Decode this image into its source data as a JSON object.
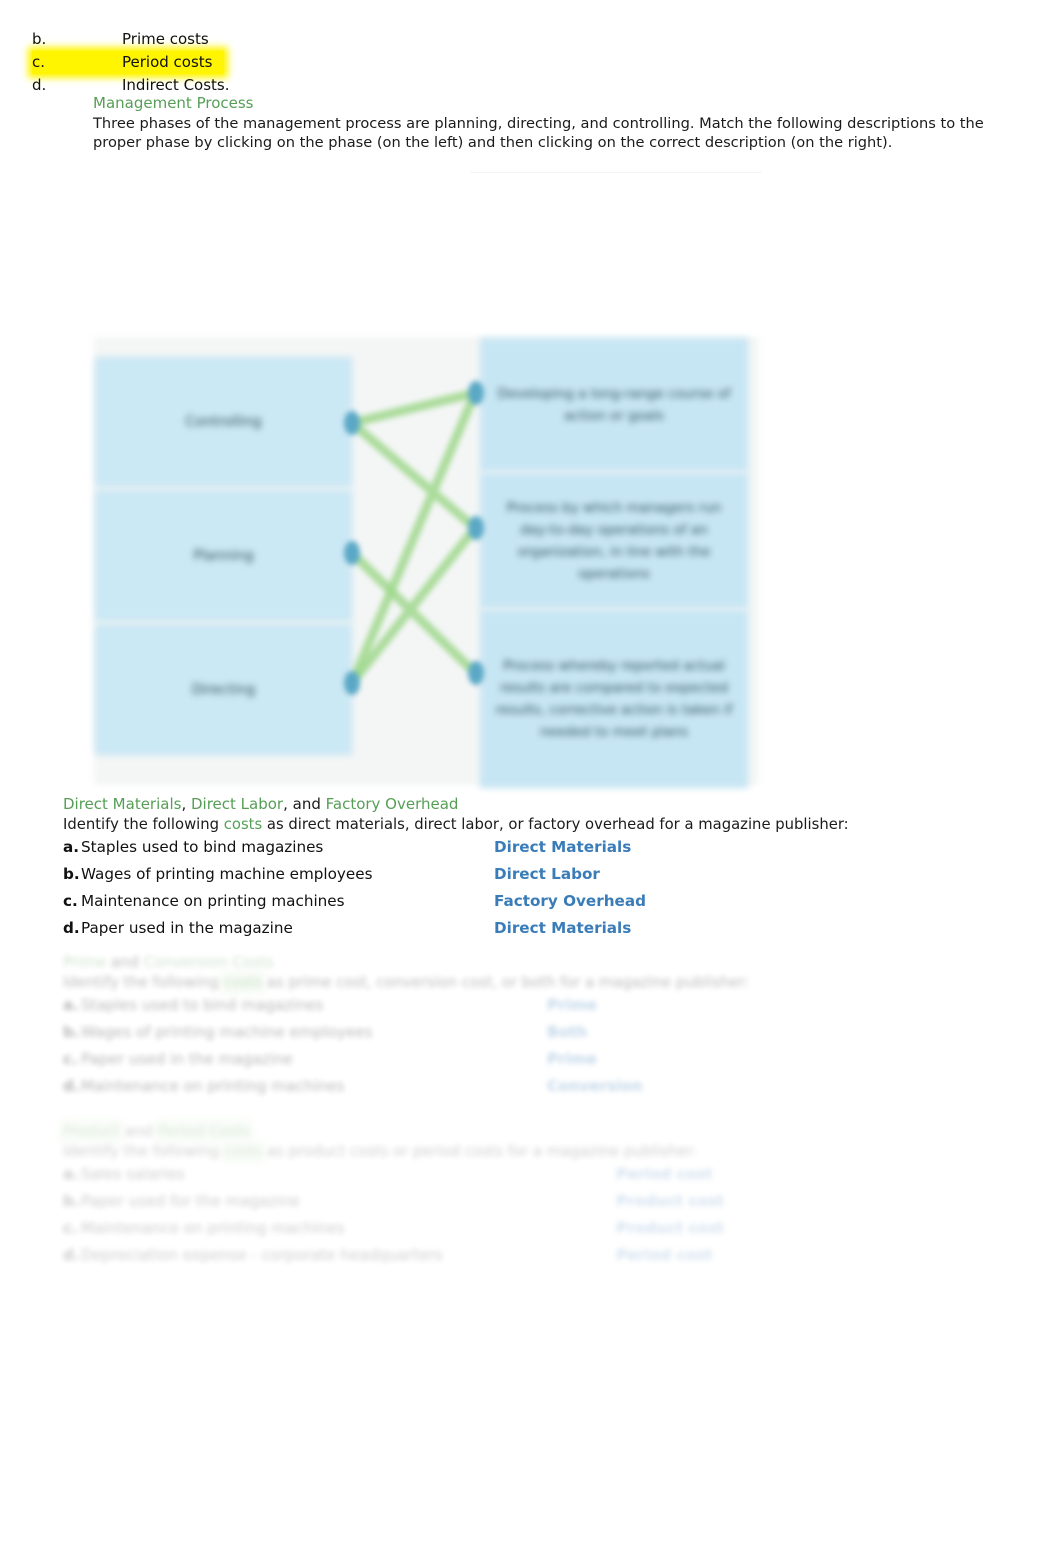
{
  "mc_options": [
    {
      "letter": "b.",
      "label": "Prime costs",
      "highlighted": false
    },
    {
      "letter": "c.",
      "label": "Period costs",
      "highlighted": true
    },
    {
      "letter": "d.",
      "label": "Indirect Costs.",
      "highlighted": false
    }
  ],
  "management_process": {
    "heading": "Management Process",
    "paragraph": "Three phases of the management process are planning, directing, and controlling. Match the following descriptions to the proper phase by clicking on the phase (on the left) and then clicking on the correct description (on the right)."
  },
  "diagram": {
    "phases": [
      {
        "label": "Controlling"
      },
      {
        "label": "Planning"
      },
      {
        "label": "Directing"
      }
    ],
    "descriptions": [
      {
        "text": "Developing a long-range course of action or goals"
      },
      {
        "text": "Process by which managers run day-to-day operations of an organization, in line with the operations"
      },
      {
        "text": "Process whereby reported actual results are compared to expected results, corrective action is taken if needed to meet plans"
      }
    ],
    "connections": "planning-to-first, directing-to-second, controlling-to-third crossed"
  },
  "direct_section": {
    "heading_parts": [
      "Direct Materials",
      ", ",
      "Direct Labor",
      ", and ",
      "Factory Overhead"
    ],
    "intro_before": "Identify the following ",
    "intro_green": "costs",
    "intro_after": " as direct materials, direct labor, or factory overhead for a magazine publisher:",
    "items": [
      {
        "letter": "a.",
        "text": "Staples used to bind magazines",
        "answer": "Direct Materials"
      },
      {
        "letter": "b.",
        "text": "Wages of printing machine employees",
        "answer": "Direct Labor"
      },
      {
        "letter": "c.",
        "text": "Maintenance on printing machines",
        "answer": "Factory Overhead"
      },
      {
        "letter": "d.",
        "text": "Paper used in the magazine",
        "answer": "Direct Materials"
      }
    ]
  },
  "prime_section": {
    "heading_parts": [
      "Prime",
      " and ",
      "Conversion Costs"
    ],
    "intro_before": "Identify the following ",
    "intro_green": "costs",
    "intro_after": " as prime cost, conversion cost, or both for a magazine publisher:",
    "items": [
      {
        "letter": "a.",
        "text": "Staples used to bind magazines",
        "answer": "Prime"
      },
      {
        "letter": "b.",
        "text": "Wages of printing machine employees",
        "answer": "Both"
      },
      {
        "letter": "c.",
        "text": "Paper used in the magazine",
        "answer": "Prime"
      },
      {
        "letter": "d.",
        "text": "Maintenance on printing machines",
        "answer": "Conversion"
      }
    ]
  },
  "product_section": {
    "heading_parts": [
      "Product",
      " and ",
      "Period Costs"
    ],
    "intro_before": "Identify the following ",
    "intro_green": "costs",
    "intro_after": " as product costs or period costs for a magazine publisher:",
    "items": [
      {
        "letter": "a.",
        "text": "Sales salaries",
        "answer": "Period cost"
      },
      {
        "letter": "b.",
        "text": "Paper used for the magazine",
        "answer": "Product cost"
      },
      {
        "letter": "c.",
        "text": "Maintenance on printing machines",
        "answer": "Product cost"
      },
      {
        "letter": "d.",
        "text": "Depreciation expense - corporate headquarters",
        "answer": "Period cost"
      }
    ]
  },
  "colors": {
    "green_heading": "#56a05a",
    "blue_answer": "#3a7cb8",
    "highlight_yellow": "#fff500",
    "box_blue": "#c7e6f4",
    "connector_green": "#9fd88c",
    "node_blue": "#5aa8c6"
  }
}
